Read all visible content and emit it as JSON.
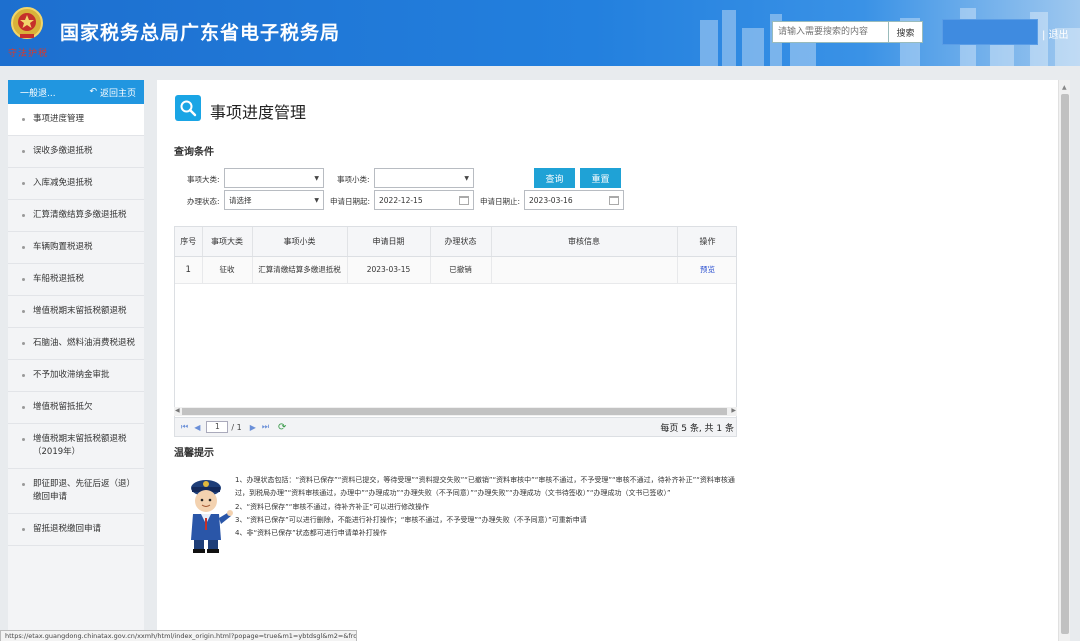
{
  "header": {
    "title": "国家税务总局广东省电子税务局",
    "motto": "守法护税",
    "search_placeholder": "请输入需要搜索的内容",
    "search_button": "搜索",
    "logout": "| 退出"
  },
  "sidebar": {
    "head_label": "一般退...",
    "back_label": "返回主页",
    "items": [
      {
        "label": "事项进度管理"
      },
      {
        "label": "误收多缴退抵税"
      },
      {
        "label": "入库减免退抵税"
      },
      {
        "label": "汇算清缴结算多缴退抵税"
      },
      {
        "label": "车辆购置税退税"
      },
      {
        "label": "车船税退抵税"
      },
      {
        "label": "增值税期末留抵税额退税"
      },
      {
        "label": "石脑油、燃料油消费税退税"
      },
      {
        "label": "不予加收滞纳金审批"
      },
      {
        "label": "增值税留抵抵欠"
      },
      {
        "label": "增值税期末留抵税额退税（2019年）"
      },
      {
        "label": "即征即退、先征后返（退）缴回申请"
      },
      {
        "label": "留抵退税缴回申请"
      }
    ]
  },
  "main": {
    "page_title": "事项进度管理",
    "query_title": "查询条件",
    "filters": {
      "category_label": "事项大类:",
      "category_value": "",
      "subcategory_label": "事项小类:",
      "subcategory_value": "",
      "status_label": "办理状态:",
      "status_value": "请选择",
      "date_from_label": "申请日期起:",
      "date_from": "2022-12-15",
      "date_to_label": "申请日期止:",
      "date_to": "2023-03-16"
    },
    "query_button": "查询",
    "reset_button": "重置",
    "table": {
      "headers": [
        "序号",
        "事项大类",
        "事项小类",
        "申请日期",
        "办理状态",
        "审核信息",
        "操作"
      ],
      "rows": [
        [
          "1",
          "征收",
          "汇算清缴结算多缴退抵税",
          "2023-03-15",
          "已撤销",
          "",
          "预览"
        ]
      ]
    },
    "pager": {
      "first": "⏮",
      "prev": "◀",
      "page": "1",
      "total_pages": "/ 1",
      "next": "▶",
      "last": "⏭",
      "info": "每页 5 条, 共 1 条"
    },
    "tips_title": "温馨提示",
    "tips": [
      "1、办理状态包括：“资料已保存”“资料已提交，等待受理”“资料提交失败”“已撤销”“资料审核中”“审核不通过，不予受理”“审核不通过，待补齐补正”“资料审核通过，到税局办理”“资料审核通过，办理中”“办理成功”“办理失败（不予同意）”“办理失败”“办理成功（文书待签收）”“办理成功（文书已签收）”",
      "2、“资料已保存”“审核不通过，待补齐补正”可以进行修改操作",
      "3、“资料已保存”可以进行删除，不能进行补打操作；“审核不通过，不予受理”“办理失败（不予同意）”可重新申请",
      "4、非“资料已保存”状态都可进行申请单补打操作"
    ]
  },
  "statusbar": "https://etax.guangdong.chinatax.gov.cn/xxmh/html/index_origin.html?popage=true&m1=ybtdsgl&m2=&from..."
}
